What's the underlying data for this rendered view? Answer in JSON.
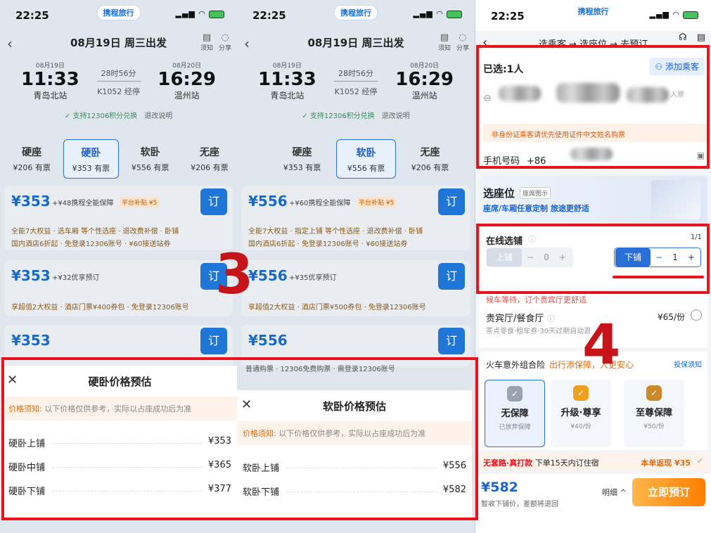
{
  "common": {
    "time": "22:25",
    "brand": "携程旅行",
    "date_title": "08月19日 周三出发",
    "notice_icon_label": "须知",
    "share_icon_label": "分享",
    "dep_date": "08月19日",
    "dep_time": "11:33",
    "dep_station": "青岛北站",
    "duration": "28时56分",
    "train_no": "K1052 经停",
    "arr_date": "08月20日",
    "arr_time": "16:29",
    "arr_station": "温州站",
    "support": "支持12306积分兑换",
    "refund": "退改说明"
  },
  "panel1": {
    "seats": [
      {
        "name": "硬座",
        "price": "¥206",
        "status": "有票"
      },
      {
        "name": "硬卧",
        "price": "¥353",
        "status": "有票"
      },
      {
        "name": "软卧",
        "price": "¥556",
        "status": "有票"
      },
      {
        "name": "无座",
        "price": "¥206",
        "status": "有票"
      }
    ],
    "offers": [
      {
        "price": "¥353",
        "label": "+¥48携程全能保障",
        "sub": "平台补贴 ¥5",
        "book": "订",
        "perk1": "全能7大权益 · 选车厢 等个性选座 · 退改费补偿 · 卧铺",
        "perk2": "国内酒店6折起 · 免登录12306账号 · ¥60接送站券"
      },
      {
        "price": "¥353",
        "label": "+¥32优享预订",
        "book": "订",
        "perk1": "享超值2大权益 · 酒店门票¥400券包 · 免登录12306账号"
      },
      {
        "price": "¥353",
        "book": "订"
      }
    ],
    "sheet": {
      "title": "硬卧价格预估",
      "notice_label": "价格须知:",
      "notice": "以下价格仅供参考，实际以占座成功后为准",
      "rows": [
        {
          "name": "硬卧上铺",
          "price": "¥353"
        },
        {
          "name": "硬卧中铺",
          "price": "¥365"
        },
        {
          "name": "硬卧下铺",
          "price": "¥377"
        }
      ]
    }
  },
  "panel2": {
    "seats": [
      {
        "name": "硬座",
        "price": "¥353",
        "status": "有票"
      },
      {
        "name": "软卧",
        "price": "¥556",
        "status": "有票"
      },
      {
        "name": "无座",
        "price": "¥206",
        "status": "有票"
      }
    ],
    "offers": [
      {
        "price": "¥556",
        "label": "+¥60携程全能保障",
        "sub": "平台补贴 ¥5",
        "book": "订",
        "perk1": "全能7大权益 · 指定上铺 等个性选座 · 退改费补偿 · 卧铺",
        "perk2": "国内酒店6折起 · 免登录12306账号 · ¥60接送站券"
      },
      {
        "price": "¥556",
        "label": "+¥35优享预订",
        "book": "订",
        "perk1": "享超值2大权益 · 酒店门票¥500券包 · 免登录12306账号"
      },
      {
        "price": "¥556",
        "book": "订"
      }
    ],
    "peek": "普通购票 · 12306免费购票 · 需登录12306账号",
    "sheet": {
      "title": "软卧价格预估",
      "notice_label": "价格须知:",
      "notice": "以下价格仅供参考，实际以占座成功后为准",
      "rows": [
        {
          "name": "软卧上铺",
          "price": "¥556"
        },
        {
          "name": "软卧下铺",
          "price": "¥582"
        }
      ]
    }
  },
  "panel3": {
    "steps": "选乘客 → 选座位 → 去预订",
    "selected": "已选:1人",
    "add_passenger": "添加乘客",
    "id_suffix": "入票",
    "warning": "非身份证乘客请优先使用证件中文姓名购票",
    "phone_label": "手机号码",
    "phone_prefix": "+86",
    "seat_title": "选座位",
    "seat_tag": "座席图示",
    "seat_sub": "座席/车厢任意定制 旅途更舒适",
    "berth_title": "在线选铺",
    "berth_count": "1/1",
    "upper_label": "上铺",
    "upper_value": "0",
    "lower_label": "下铺",
    "lower_value": "1",
    "wait_text": "候车等待，订个贵宾厅更舒适",
    "vip_title": "贵宾厅/餐食厅",
    "vip_price": "¥65/份",
    "vip_sub": "茶点零食·租车券·30天过期自动退",
    "ins_title": "火车意外组合险",
    "ins_sub": "出行添保障，人更安心",
    "ins_notice": "投保须知",
    "plans": [
      {
        "name": "无保障",
        "price": "已放弃保障"
      },
      {
        "name": "升级·尊享",
        "price": "¥40/份"
      },
      {
        "name": "至尊保障",
        "price": "¥50/份"
      }
    ],
    "rebate_tag": "无套路·真打款",
    "rebate": "下单15天内订住宿",
    "rebate_right": "本单返现 ¥35",
    "total": "¥582",
    "total_note": "暂收下铺价，差额将退回",
    "detail": "明细 ^",
    "book": "立即预订"
  },
  "steps": {
    "three": "3",
    "four": "4"
  },
  "colors": {
    "accent": "#1f76d6",
    "highlight": "#e8131c",
    "order": "#ff7f00"
  }
}
